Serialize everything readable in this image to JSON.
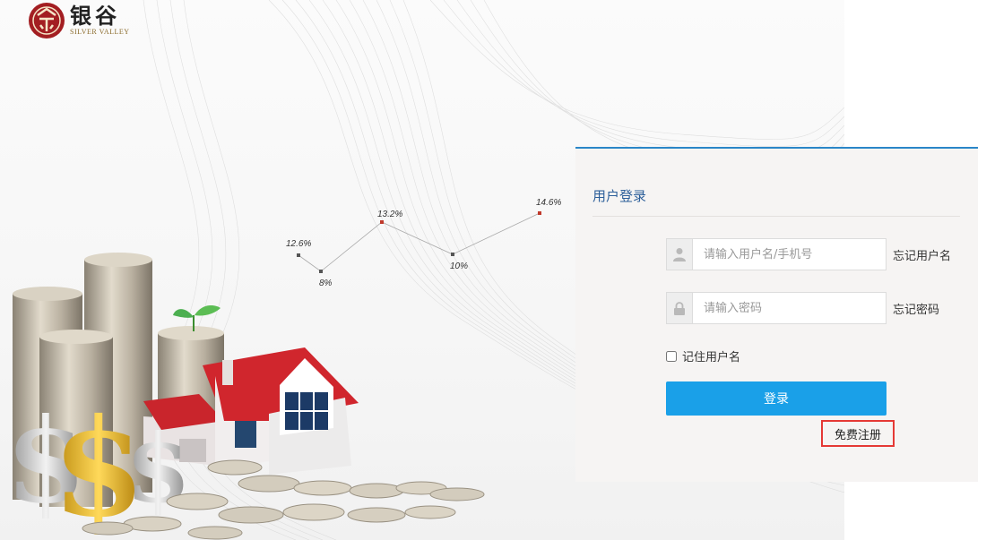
{
  "logo": {
    "cn": "银谷",
    "en": "SILVER VALLEY"
  },
  "chart": {
    "rates": [
      "12.6%",
      "8%",
      "13.2%",
      "10%",
      "14.6%"
    ]
  },
  "login": {
    "title": "用户登录",
    "username_placeholder": "请输入用户名/手机号",
    "password_placeholder": "请输入密码",
    "forgot_username": "忘记用户名",
    "forgot_password": "忘记密码",
    "remember_label": "记住用户名",
    "submit_label": "登录",
    "register_label": "免费注册"
  },
  "colors": {
    "accent_blue": "#1aa0e8",
    "title_blue": "#2d5f9a",
    "panel_border": "#2a86c8",
    "highlight_red": "#e53935"
  }
}
